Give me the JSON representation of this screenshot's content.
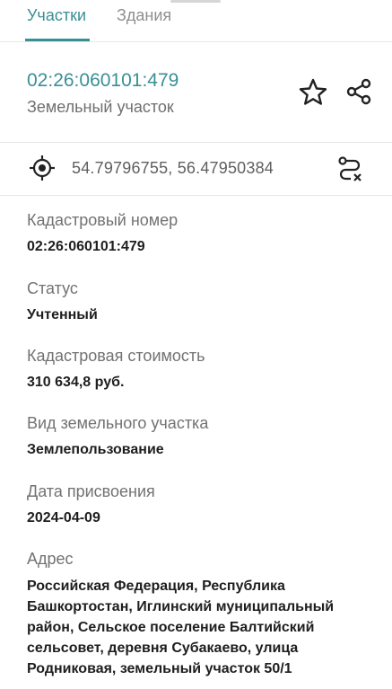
{
  "tabs": [
    {
      "label": "Участки",
      "active": true
    },
    {
      "label": "Здания",
      "active": false
    }
  ],
  "header": {
    "cadastral_link": "02:26:060101:479",
    "object_type": "Земельный участок",
    "icons": {
      "favorite": "star-outline-icon",
      "share": "share-icon"
    }
  },
  "coordinates": {
    "text": "54.79796755, 56.47950384",
    "icons": {
      "locate": "crosshair-icon",
      "route": "route-icon"
    }
  },
  "fields": [
    {
      "label": "Кадастровый номер",
      "value": "02:26:060101:479"
    },
    {
      "label": "Статус",
      "value": "Учтенный"
    },
    {
      "label": "Кадастровая стоимость",
      "value": "310 634,8 руб."
    },
    {
      "label": "Вид земельного участка",
      "value": "Землепользование"
    },
    {
      "label": "Дата присвоения",
      "value": "2024-04-09"
    },
    {
      "label": "Адрес",
      "value": "Российская Федерация, Республика Башкортостан, Иглинский муниципальный район, Сельское поселение Балтийский сельсовет, деревня Субакаево, улица Родниковая, земельный участок 50/1"
    }
  ],
  "colors": {
    "accent": "#3a8f95",
    "label": "#727272",
    "value": "#1e1e1e"
  }
}
